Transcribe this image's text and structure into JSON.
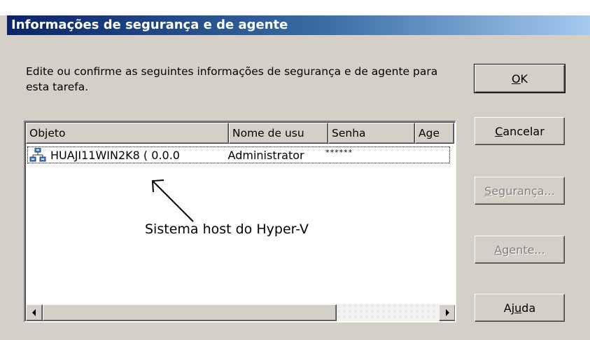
{
  "window": {
    "title": "Informações de segurança e de agente"
  },
  "instructions": "Edite ou confirme as seguintes informações de segurança e de agente para esta tarefa.",
  "list": {
    "columns": [
      "Objeto",
      "Nome de usu",
      "Senha",
      "Age"
    ],
    "rows": [
      {
        "icon": "network-computer-icon",
        "object": "HUAJI11WIN2K8 ( 0.0.0",
        "user": "Administrator",
        "password": "******",
        "agent": ""
      }
    ]
  },
  "buttons": {
    "ok": {
      "mnemonic": "O",
      "rest": "K"
    },
    "cancel": {
      "mnemonic": "C",
      "rest": "ancelar"
    },
    "security": {
      "mnemonic": "S",
      "rest": "egurança..."
    },
    "agent": {
      "mnemonic": "A",
      "rest": "gente..."
    },
    "help": {
      "pre": "Aj",
      "mnemonic": "u",
      "rest": "da"
    }
  },
  "annotation": "Sistema host do Hyper-V",
  "colors": {
    "dialog_bg": "#d4d0c8",
    "title_start": "#0a246a",
    "title_end": "#a6caf0"
  }
}
